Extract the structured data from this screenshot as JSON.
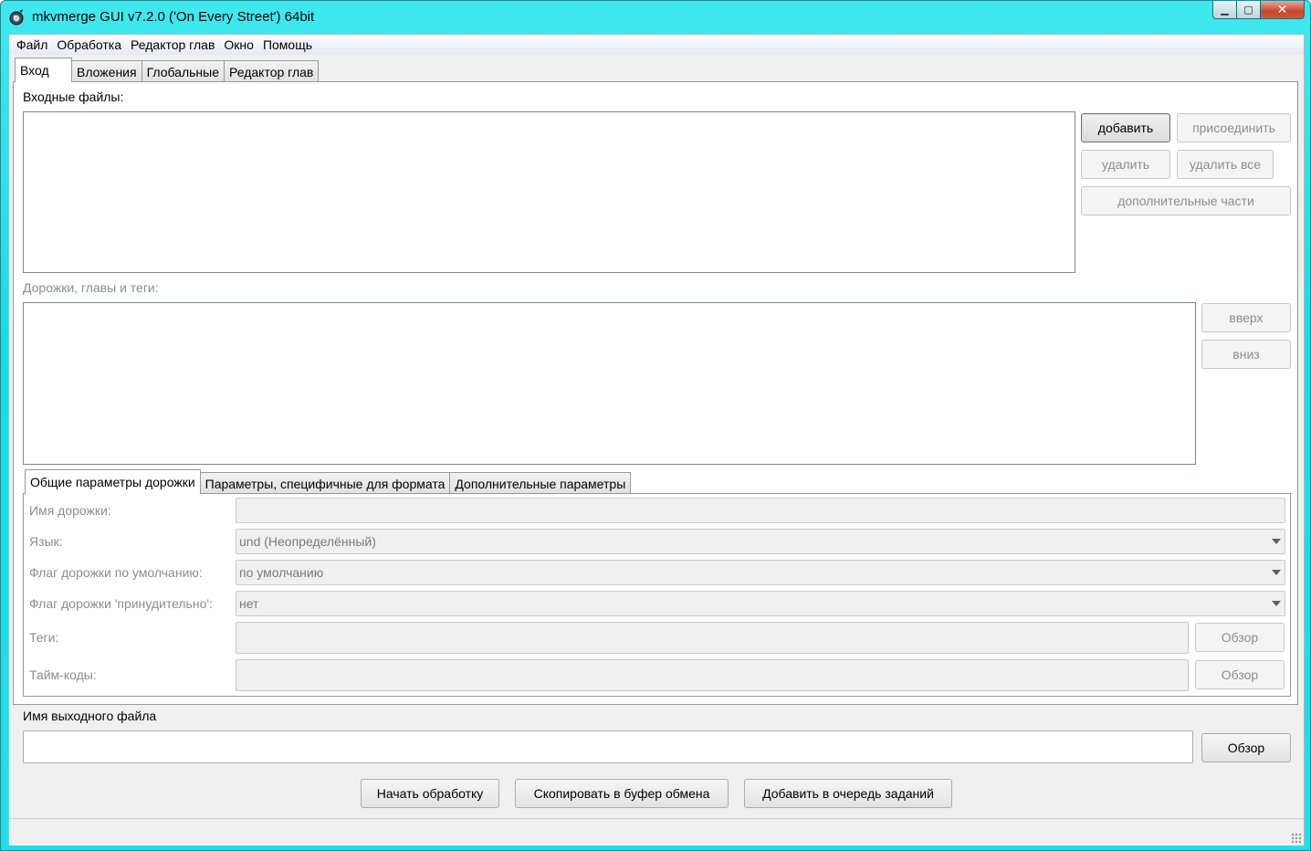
{
  "window": {
    "title": "mkvmerge GUI v7.2.0 ('On Every Street') 64bit",
    "minimize": "▁",
    "maximize": "▢",
    "close": "✕"
  },
  "menu": [
    "Файл",
    "Обработка",
    "Редактор глав",
    "Окно",
    "Помощь"
  ],
  "main_tabs": [
    "Вход",
    "Вложения",
    "Глобальные",
    "Редактор глав"
  ],
  "input": {
    "files_label": "Входные файлы:",
    "add": "добавить",
    "append": "присоединить",
    "remove": "удалить",
    "remove_all": "удалить все",
    "additional_parts": "дополнительные части",
    "tracks_label": "Дорожки, главы и теги:",
    "up": "вверх",
    "down": "вниз"
  },
  "track_tabs": [
    "Общие параметры дорожки",
    "Параметры, специфичные для формата",
    "Дополнительные параметры"
  ],
  "track_params": {
    "track_name_label": "Имя дорожки:",
    "track_name_value": "",
    "language_label": "Язык:",
    "language_value": "und (Неопределённый)",
    "default_flag_label": "Флаг дорожки по умолчанию:",
    "default_flag_value": "по умолчанию",
    "forced_flag_label": "Флаг дорожки 'принудительно':",
    "forced_flag_value": "нет",
    "tags_label": "Теги:",
    "tags_value": "",
    "timecodes_label": "Тайм-коды:",
    "timecodes_value": "",
    "browse": "Обзор"
  },
  "output": {
    "label": "Имя выходного файла",
    "value": "",
    "browse": "Обзор"
  },
  "actions": {
    "start": "Начать обработку",
    "copy": "Скопировать в буфер обмена",
    "queue": "Добавить в очередь заданий"
  }
}
